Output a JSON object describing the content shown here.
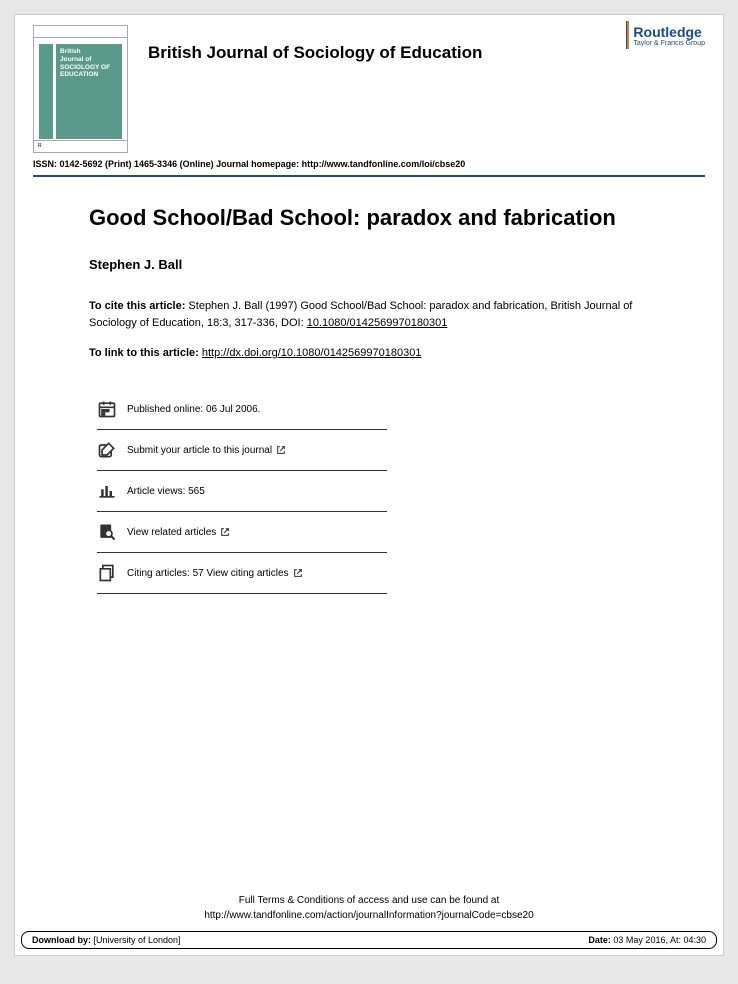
{
  "header": {
    "journal_title": "British Journal of Sociology of Education",
    "cover": {
      "line1": "British",
      "line2": "Journal of",
      "line3": "SOCIOLOGY OF",
      "line4": "EDUCATION"
    },
    "publisher": {
      "name": "Routledge",
      "sub": "Taylor & Francis Group"
    },
    "issn_line": "ISSN: 0142-5692 (Print) 1465-3346 (Online) Journal homepage: http://www.tandfonline.com/loi/cbse20"
  },
  "article": {
    "title": "Good School/Bad School: paradox and fabrication",
    "author": "Stephen J. Ball",
    "cite_label": "To cite this article:",
    "cite_text": " Stephen J. Ball (1997) Good School/Bad School: paradox and fabrication, British Journal of Sociology of Education, 18:3, 317-336, DOI: ",
    "cite_doi": "10.1080/0142569970180301",
    "link_label": "To link to this article:  ",
    "link_url": "http://dx.doi.org/10.1080/0142569970180301"
  },
  "actions": {
    "published": "Published online: 06 Jul 2006.",
    "submit": "Submit your article to this journal",
    "views": "Article views: 565",
    "related": "View related articles",
    "citing": "Citing articles: 57 View citing articles"
  },
  "footer": {
    "terms1": "Full Terms & Conditions of access and use can be found at",
    "terms2": "http://www.tandfonline.com/action/journalInformation?journalCode=cbse20",
    "download_label": "Download by:",
    "download_by": " [University of London]",
    "date_label": "Date:",
    "date_value": " 03 May 2016, At: 04:30"
  }
}
